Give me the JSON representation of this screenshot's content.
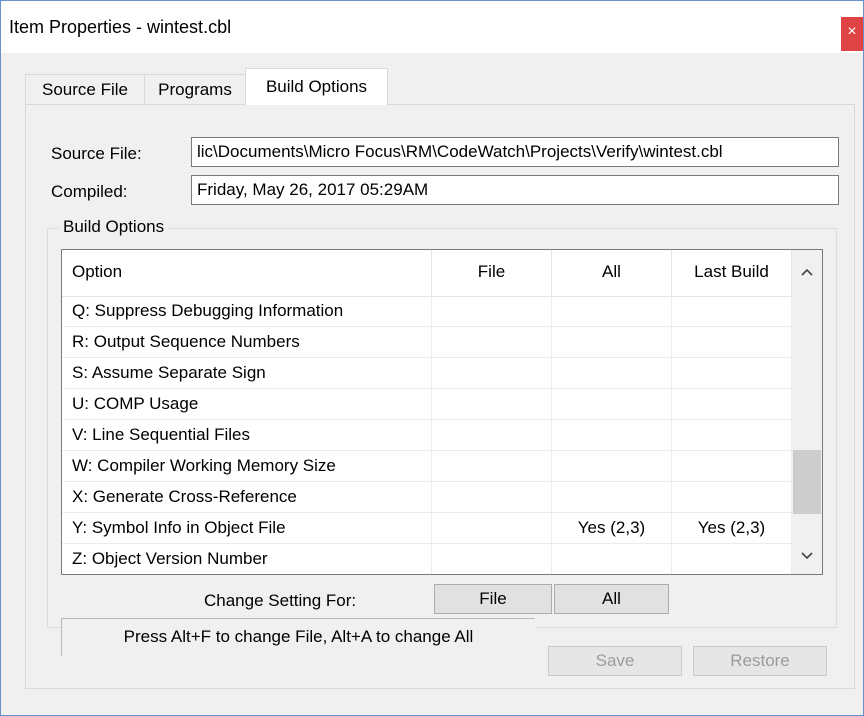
{
  "window": {
    "title": "Item Properties - wintest.cbl",
    "close_label": "×"
  },
  "tabs": [
    {
      "label": "Source File",
      "active": false
    },
    {
      "label": "Programs",
      "active": false
    },
    {
      "label": "Build Options",
      "active": true
    }
  ],
  "source": {
    "label": "Source File:",
    "value": "lic\\Documents\\Micro Focus\\RM\\CodeWatch\\Projects\\Verify\\wintest.cbl"
  },
  "compiled": {
    "label": "Compiled:",
    "value": "Friday, May 26, 2017 05:29AM"
  },
  "build_options": {
    "group_title": "Build Options",
    "columns": [
      "Option",
      "File",
      "All",
      "Last Build"
    ],
    "rows": [
      {
        "option": "Q: Suppress Debugging Information",
        "file": "",
        "all": "",
        "last": ""
      },
      {
        "option": "R: Output Sequence Numbers",
        "file": "",
        "all": "",
        "last": ""
      },
      {
        "option": "S: Assume Separate Sign",
        "file": "",
        "all": "",
        "last": ""
      },
      {
        "option": "U: COMP Usage",
        "file": "",
        "all": "",
        "last": ""
      },
      {
        "option": "V: Line Sequential Files",
        "file": "",
        "all": "",
        "last": ""
      },
      {
        "option": "W: Compiler Working Memory Size",
        "file": "",
        "all": "",
        "last": ""
      },
      {
        "option": "X: Generate Cross-Reference",
        "file": "",
        "all": "",
        "last": ""
      },
      {
        "option": "Y: Symbol Info in Object File",
        "file": "",
        "all": "Yes (2,3)",
        "last": "Yes (2,3)"
      },
      {
        "option": "Z: Object Version Number",
        "file": "",
        "all": "",
        "last": ""
      }
    ],
    "scroll_up_icon": "chevron-up-icon",
    "scroll_down_icon": "chevron-down-icon"
  },
  "change_setting": {
    "label": "Change Setting For:",
    "file_button": "File",
    "all_button": "All"
  },
  "status": {
    "text": "Press Alt+F to change File, Alt+A to change All"
  },
  "actions": {
    "save": "Save",
    "restore": "Restore"
  },
  "colors": {
    "close_button": "#e04343",
    "window_border": "#6d8fc9",
    "disabled_text": "#9b9b9b"
  }
}
